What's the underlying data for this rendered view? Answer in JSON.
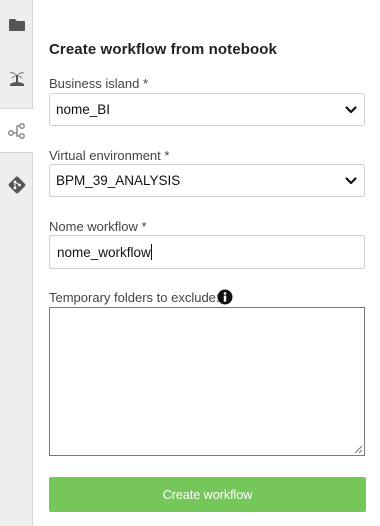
{
  "sidebar": {
    "tabs": [
      {
        "icon": "folder-icon"
      },
      {
        "icon": "island-icon"
      },
      {
        "icon": "workflow-icon",
        "active": true
      },
      {
        "icon": "git-icon"
      }
    ]
  },
  "form": {
    "title": "Create workflow from notebook",
    "business_island": {
      "label": "Business island *",
      "value": "nome_BI"
    },
    "virtual_environment": {
      "label": "Virtual environment *",
      "value": "BPM_39_ANALYSIS"
    },
    "workflow_name": {
      "label": "Nome workflow *",
      "value": "nome_workflow"
    },
    "temp_folders": {
      "label": "Temporary folders to exclude:",
      "value": ""
    },
    "submit_label": "Create workflow"
  },
  "colors": {
    "accent_green": "#76c75a",
    "sidebar_bg": "#eeeeee",
    "icon_gray": "#555555"
  }
}
